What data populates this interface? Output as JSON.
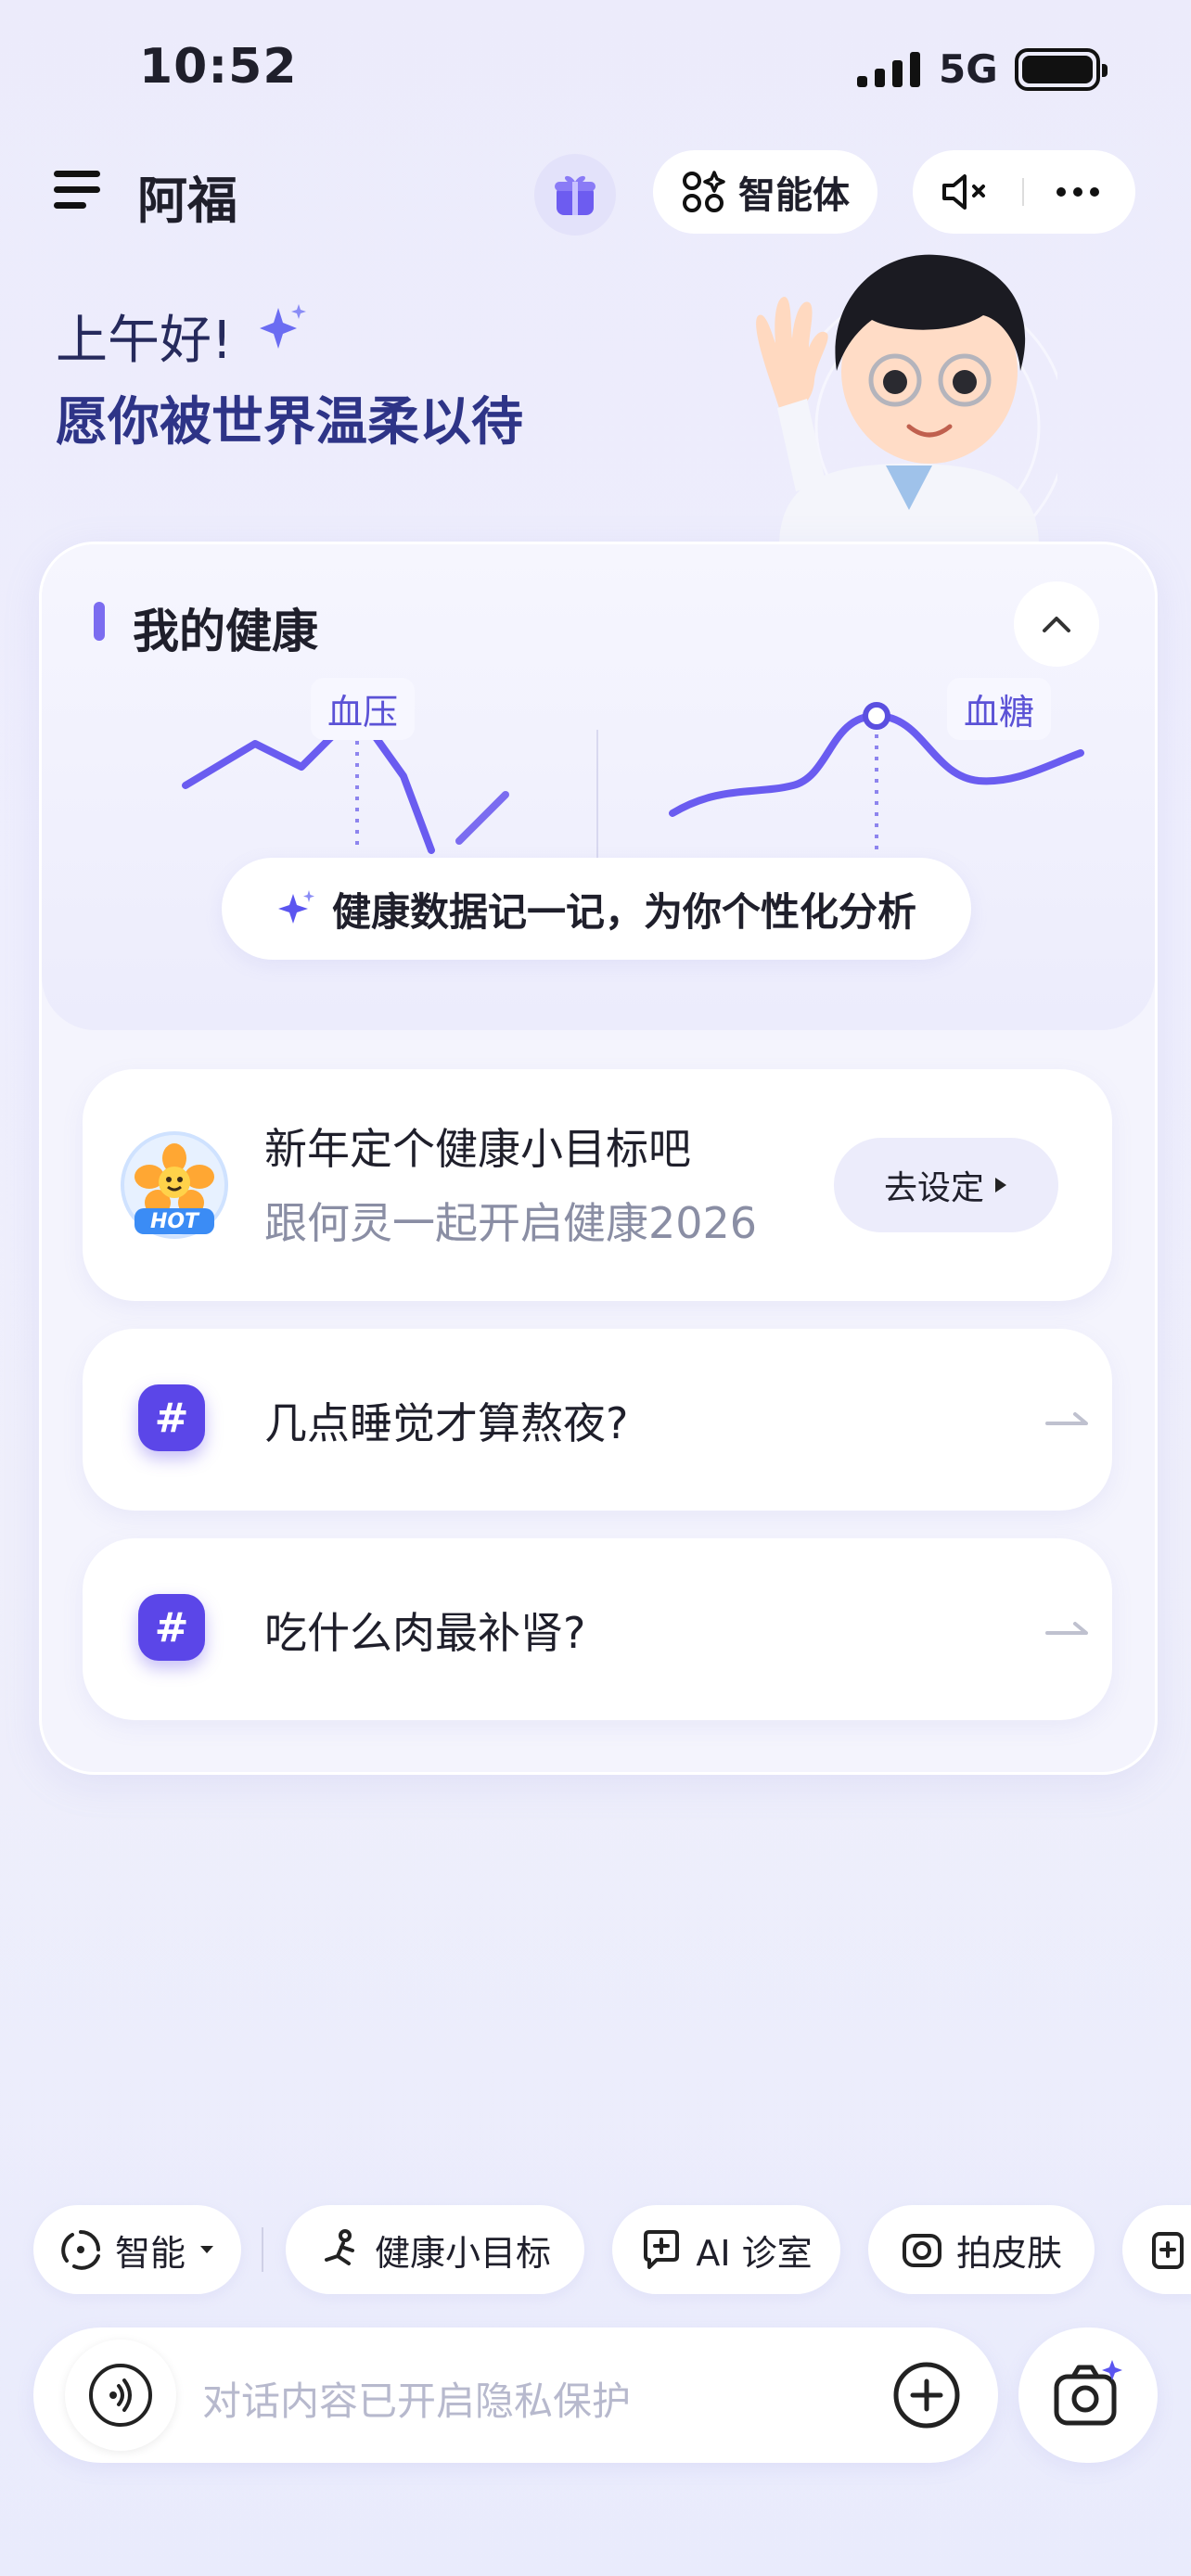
{
  "status_bar": {
    "time": "10:52",
    "network": "5G"
  },
  "header": {
    "title": "阿福",
    "agent_label": "智能体"
  },
  "greeting": {
    "line1": "上午好!",
    "line2": "愿你被世界温柔以待"
  },
  "health": {
    "title": "我的健康",
    "bp_label": "血压",
    "bs_label": "血糖",
    "cta": "健康数据记一记，为你个性化分析"
  },
  "goal_card": {
    "title": "新年定个健康小目标吧",
    "subtitle": "跟何灵一起开启健康2026",
    "button": "去设定",
    "badge": "HOT"
  },
  "questions": [
    {
      "text": "几点睡觉才算熬夜?"
    },
    {
      "text": "吃什么肉最补肾?"
    }
  ],
  "chips": {
    "mode": "智能",
    "goal": "健康小目标",
    "clinic": "AI 诊室",
    "skin": "拍皮肤"
  },
  "input": {
    "placeholder": "对话内容已开启隐私保护"
  },
  "colors": {
    "accent": "#5b46e8",
    "title_blue": "#2e3487"
  }
}
